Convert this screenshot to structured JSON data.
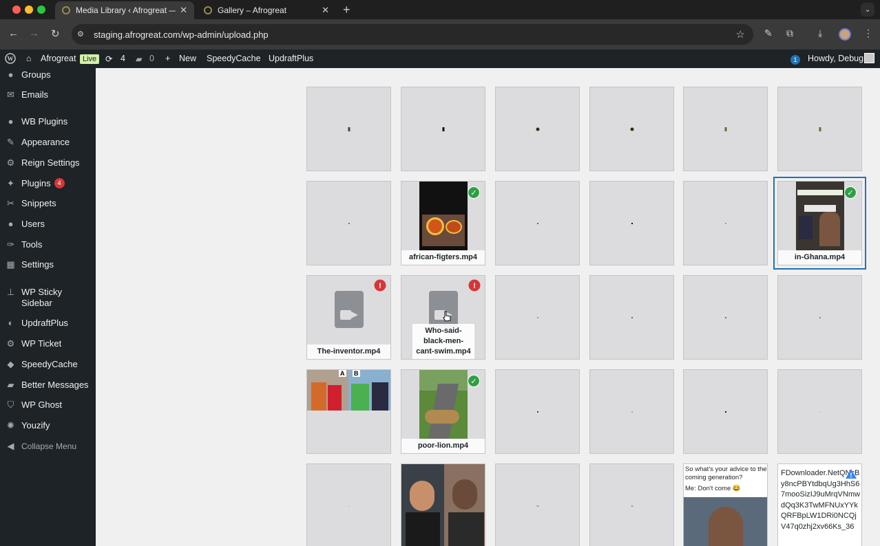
{
  "browser": {
    "tabs": [
      {
        "title": "Media Library ‹ Afrogreat — W",
        "active": true
      },
      {
        "title": "Gallery – Afrogreat",
        "active": false
      }
    ],
    "url": "staging.afrogreat.com/wp-admin/upload.php"
  },
  "adminbar": {
    "site_name": "Afrogreat",
    "live_label": "Live",
    "updates_count": "4",
    "comments_count": "0",
    "new_label": "New",
    "speedycache_label": "SpeedyCache",
    "updraftplus_label": "UpdraftPlus",
    "notification_count": "1",
    "howdy": "Howdy, Debug"
  },
  "sidebar": {
    "items": [
      {
        "label": "Groups",
        "icon": "groups-icon"
      },
      {
        "label": "Emails",
        "icon": "email-icon"
      },
      {
        "label": "WB Plugins",
        "icon": "lightbulb-icon"
      },
      {
        "label": "Appearance",
        "icon": "paintbrush-icon"
      },
      {
        "label": "Reign Settings",
        "icon": "gear-icon"
      },
      {
        "label": "Plugins",
        "icon": "plugin-icon",
        "badge": "4"
      },
      {
        "label": "Snippets",
        "icon": "scissors-icon"
      },
      {
        "label": "Users",
        "icon": "user-icon"
      },
      {
        "label": "Tools",
        "icon": "wrench-icon"
      },
      {
        "label": "Settings",
        "icon": "settings-icon"
      },
      {
        "label": "WP Sticky Sidebar",
        "icon": "pin-icon"
      },
      {
        "label": "UpdraftPlus",
        "icon": "updraft-icon"
      },
      {
        "label": "WP Ticket",
        "icon": "ticket-icon"
      },
      {
        "label": "SpeedyCache",
        "icon": "speedycache-icon"
      },
      {
        "label": "Better Messages",
        "icon": "messages-icon"
      },
      {
        "label": "WP Ghost",
        "icon": "shield-icon"
      },
      {
        "label": "Youzify",
        "icon": "youzify-icon"
      }
    ],
    "collapse_label": "Collapse Menu"
  },
  "media": {
    "filenames": {
      "african_figters": "african-figters.mp4",
      "in_ghana": "in-Ghana.mp4",
      "the_inventor": "The-inventor.mp4",
      "who_said": "Who-said-black-men-cant-swim.mp4",
      "poor_lion": "poor-lion.mp4"
    },
    "thumb_labels": {
      "a": "A",
      "b": "B"
    },
    "tweet_text": "So what's your advice to the coming generation?",
    "tweet_reply": "Me: Don't come 😂",
    "fdownloader_text": "FDownloader.NetQNcBy8ncPBYtdbqUg3HhS67mooSizIJ9uMrqVNmwdQq3K3TwMFNUxYYkQRFBpLW1DRi0NCQjV47q0zhj2xv66Ks_36"
  },
  "colors": {
    "wp_dark": "#1d2327",
    "accent_blue": "#2271b1",
    "success_green": "#2ea043",
    "error_red": "#d63638"
  }
}
